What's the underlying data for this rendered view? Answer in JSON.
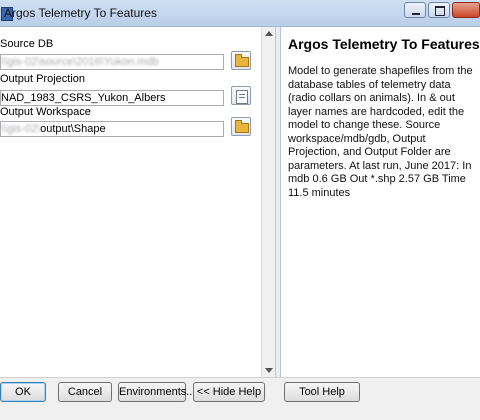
{
  "window": {
    "title": "Argos Telemetry To Features"
  },
  "params": [
    {
      "label": "Source DB",
      "value": "\\\\gis-02\\source\\2016\\Yukon.mdb",
      "blurred": true
    },
    {
      "label": "Output Projection",
      "value": "NAD_1983_CSRS_Yukon_Albers",
      "blurred": false
    },
    {
      "label": "Output Workspace",
      "prefix": "\\\\gis-02\\",
      "value": "output\\Shape",
      "blurred_prefix": true
    }
  ],
  "help": {
    "title": "Argos Telemetry To Features",
    "body": "Model to generate shapefiles from the database tables of telemetry data (radio collars on animals). In & out layer names are hardcoded, edit the model to change these. Source workspace/mdb/gdb, Output Projection, and Output Folder are parameters. At last run, June 2017: In mdb 0.6 GB Out *.shp 2.57 GB Time 11.5 minutes"
  },
  "buttons": {
    "ok": "OK",
    "cancel": "Cancel",
    "environments": "Environments...",
    "hide_help": "<< Hide Help",
    "tool_help": "Tool Help"
  },
  "icons": {
    "browse": "open-folder-icon",
    "projection": "properties-sheet-icon",
    "minimize": "minimize-icon",
    "maximize": "maximize-icon",
    "close": "close-icon"
  }
}
